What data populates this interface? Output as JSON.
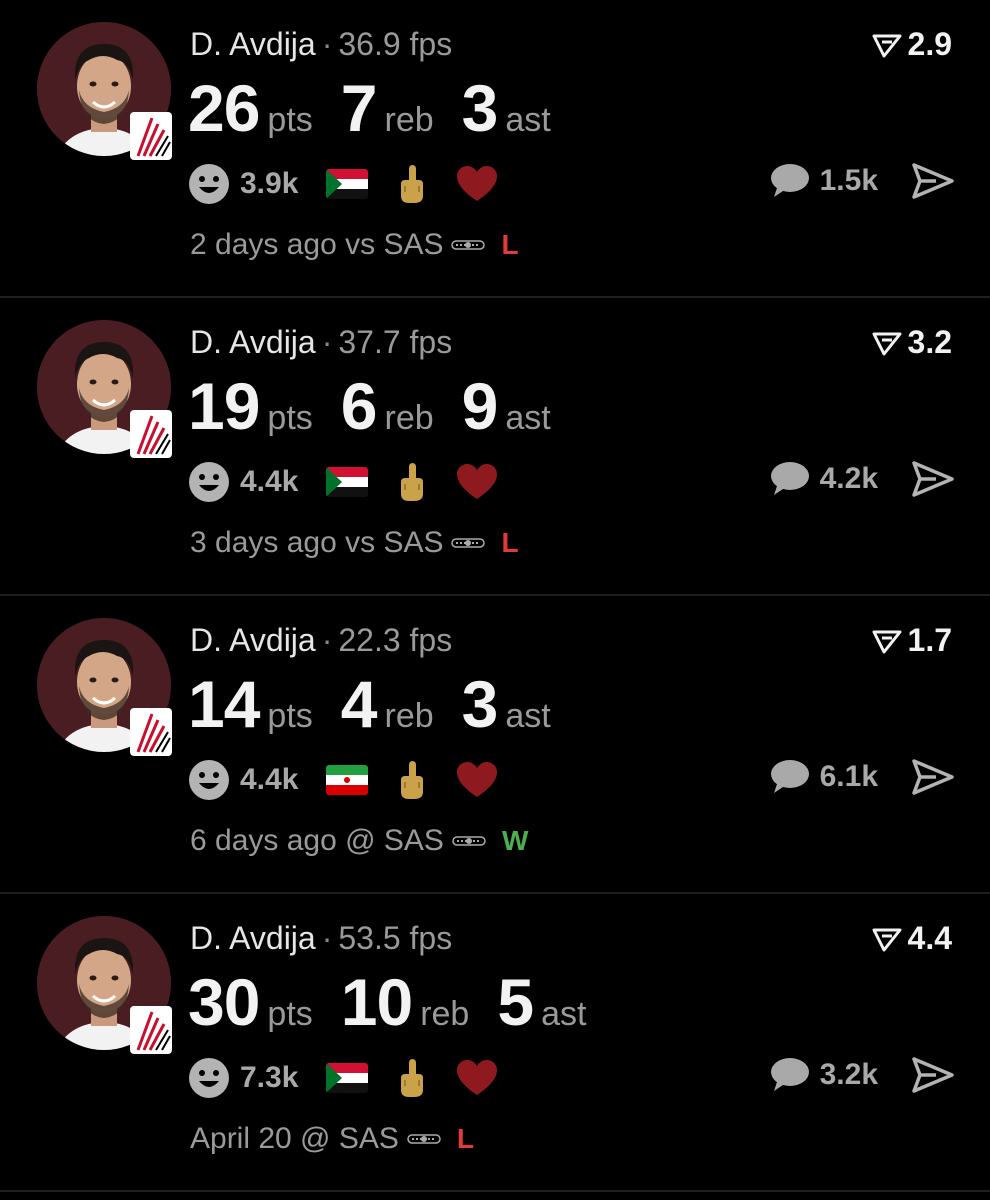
{
  "posts": [
    {
      "player": "D. Avdija",
      "fps": "36.9 fps",
      "rating": "2.9",
      "pts": "26",
      "reb": "7",
      "ast": "3",
      "pts_label": "pts",
      "reb_label": "reb",
      "ast_label": "ast",
      "reaction_count": "3.9k",
      "flag": "sudan",
      "comments": "1.5k",
      "when": "2 days ago vs SAS",
      "result": "L"
    },
    {
      "player": "D. Avdija",
      "fps": "37.7 fps",
      "rating": "3.2",
      "pts": "19",
      "reb": "6",
      "ast": "9",
      "pts_label": "pts",
      "reb_label": "reb",
      "ast_label": "ast",
      "reaction_count": "4.4k",
      "flag": "sudan",
      "comments": "4.2k",
      "when": "3 days ago vs SAS",
      "result": "L"
    },
    {
      "player": "D. Avdija",
      "fps": "22.3 fps",
      "rating": "1.7",
      "pts": "14",
      "reb": "4",
      "ast": "3",
      "pts_label": "pts",
      "reb_label": "reb",
      "ast_label": "ast",
      "reaction_count": "4.4k",
      "flag": "iran",
      "comments": "6.1k",
      "when": "6 days ago @ SAS",
      "result": "W"
    },
    {
      "player": "D. Avdija",
      "fps": "53.5 fps",
      "rating": "4.4",
      "pts": "30",
      "reb": "10",
      "ast": "5",
      "pts_label": "pts",
      "reb_label": "reb",
      "ast_label": "ast",
      "reaction_count": "7.3k",
      "flag": "sudan",
      "comments": "3.2k",
      "when": "April 20 @ SAS",
      "result": "L"
    }
  ],
  "icons": {
    "smiley": "smiley-icon",
    "finger": "middle-finger-icon",
    "heart": "heart-icon",
    "comment": "comment-bubble-icon",
    "share": "share-arrow-icon",
    "rating": "rating-icon",
    "team": "trail-blazers-logo",
    "opponent": "spurs-logo"
  },
  "colors": {
    "background": "#000000",
    "heart": "#8e1a1f",
    "finger": "#c9a24a",
    "loss": "#e03b36",
    "win": "#4caf50",
    "avatar_bg": "#4a1d22"
  }
}
